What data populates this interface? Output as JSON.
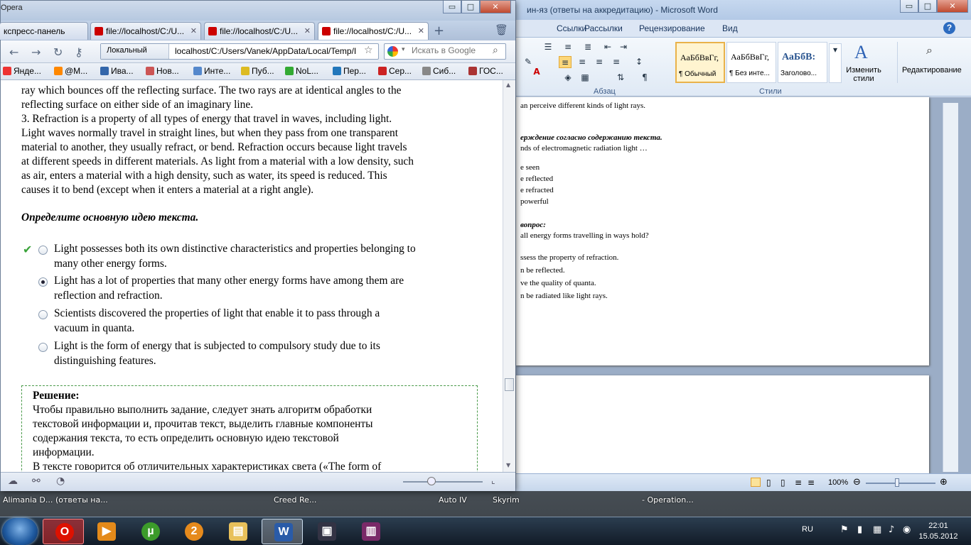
{
  "desktop": {
    "labels": [
      "Alimania D...",
      "(ответы на...",
      "Creed Re...",
      "Auto IV",
      "Skyrim",
      "- Operation..."
    ]
  },
  "word": {
    "title": "ин-яз (ответы на аккредитацию)  -  Microsoft Word",
    "window_buttons": {
      "minimize": "▭",
      "maximize": "□",
      "close": "✕"
    },
    "help_icon": "?",
    "tabs": [
      "Ссылки",
      "Рассылки",
      "Рецензирование",
      "Вид"
    ],
    "groups": {
      "paragraph": "Абзац",
      "styles": "Стили"
    },
    "styles": [
      {
        "sample": "АаБбВвГг,",
        "name": "¶ Обычный"
      },
      {
        "sample": "АаБбВвГг,",
        "name": "¶ Без инте..."
      },
      {
        "sample": "АаБбВ:",
        "name": "Заголово..."
      }
    ],
    "change_styles": "Изменить стили",
    "editing": "Редактирование",
    "doc_lines": [
      "an perceive different kinds of light rays.",
      "ерждение согласно содержанию текста.",
      "nds of electromagnetic radiation light …",
      "e seen",
      "e reflected",
      "e refracted",
      "powerful",
      "вопрос:",
      "all energy forms travelling in ways hold?",
      "ssess the property of refraction.",
      "n be reflected.",
      "ve the quality of quanta.",
      "n be radiated like light rays."
    ],
    "zoom": "100%"
  },
  "opera": {
    "app_name": "Opera",
    "tabs": [
      {
        "label": "кспресс-панель"
      },
      {
        "label": "file://localhost/C:/U..."
      },
      {
        "label": "file://localhost/C:/U..."
      },
      {
        "label": "file://localhost/C:/U..."
      }
    ],
    "site_label": "Локальный",
    "url": "localhost/C:/Users/Vanek/AppData/Local/Temp/I",
    "search_placeholder": "Искать в Google",
    "bookmarks": [
      "Янде...",
      "@M...",
      "Ива...",
      "Нов...",
      "Инте...",
      "Пуб...",
      "NoL...",
      "Пер...",
      "Сер...",
      "Сиб...",
      "ГОС..."
    ],
    "content": {
      "lines_top": [
        "ray which bounces off the reflecting surface. The two rays are at identical angles to the",
        "reflecting surface on either side of an imaginary line.",
        "3. Refraction is a property of all types of energy that travel in waves, including light.",
        "Light waves normally travel in straight lines, but when they pass from one transparent",
        "material to another, they usually refract, or bend. Refraction occurs because light travels",
        "at different speeds in different materials. As light from a material with a low density, such",
        "as air, enters a material with a high density, such as water, its speed is reduced. This",
        "causes it to bend (except when it enters a material at a right angle)."
      ],
      "question": "Определите основную идею текста.",
      "options": [
        {
          "line1": " Light possesses both its own distinctive characteristics and properties belonging to",
          "line2": "many other energy forms."
        },
        {
          "line1": " Light has a lot of properties that many other energy forms have among them are",
          "line2": "reflection and refraction."
        },
        {
          "line1": " Scientists discovered the properties of light that enable it to pass through a",
          "line2": "vacuum in quanta."
        },
        {
          "line1": " Light is the form of energy that is subjected to compulsory study due to its",
          "line2": "distinguishing features."
        }
      ],
      "solution_title": "Решение:",
      "solution_lines": [
        "Чтобы правильно выполнить задание, следует знать алгоритм обработки",
        "текстовой информации и, прочитав текст, выделить главные компоненты",
        "содержания текста, то есть определить основную идею текстовой",
        "информации.",
        "В тексте говорится об отличительных характеристиках света («The form of"
      ]
    }
  },
  "taskbar": {
    "language": "RU",
    "time": "22:01",
    "date": "15.05.2012"
  }
}
